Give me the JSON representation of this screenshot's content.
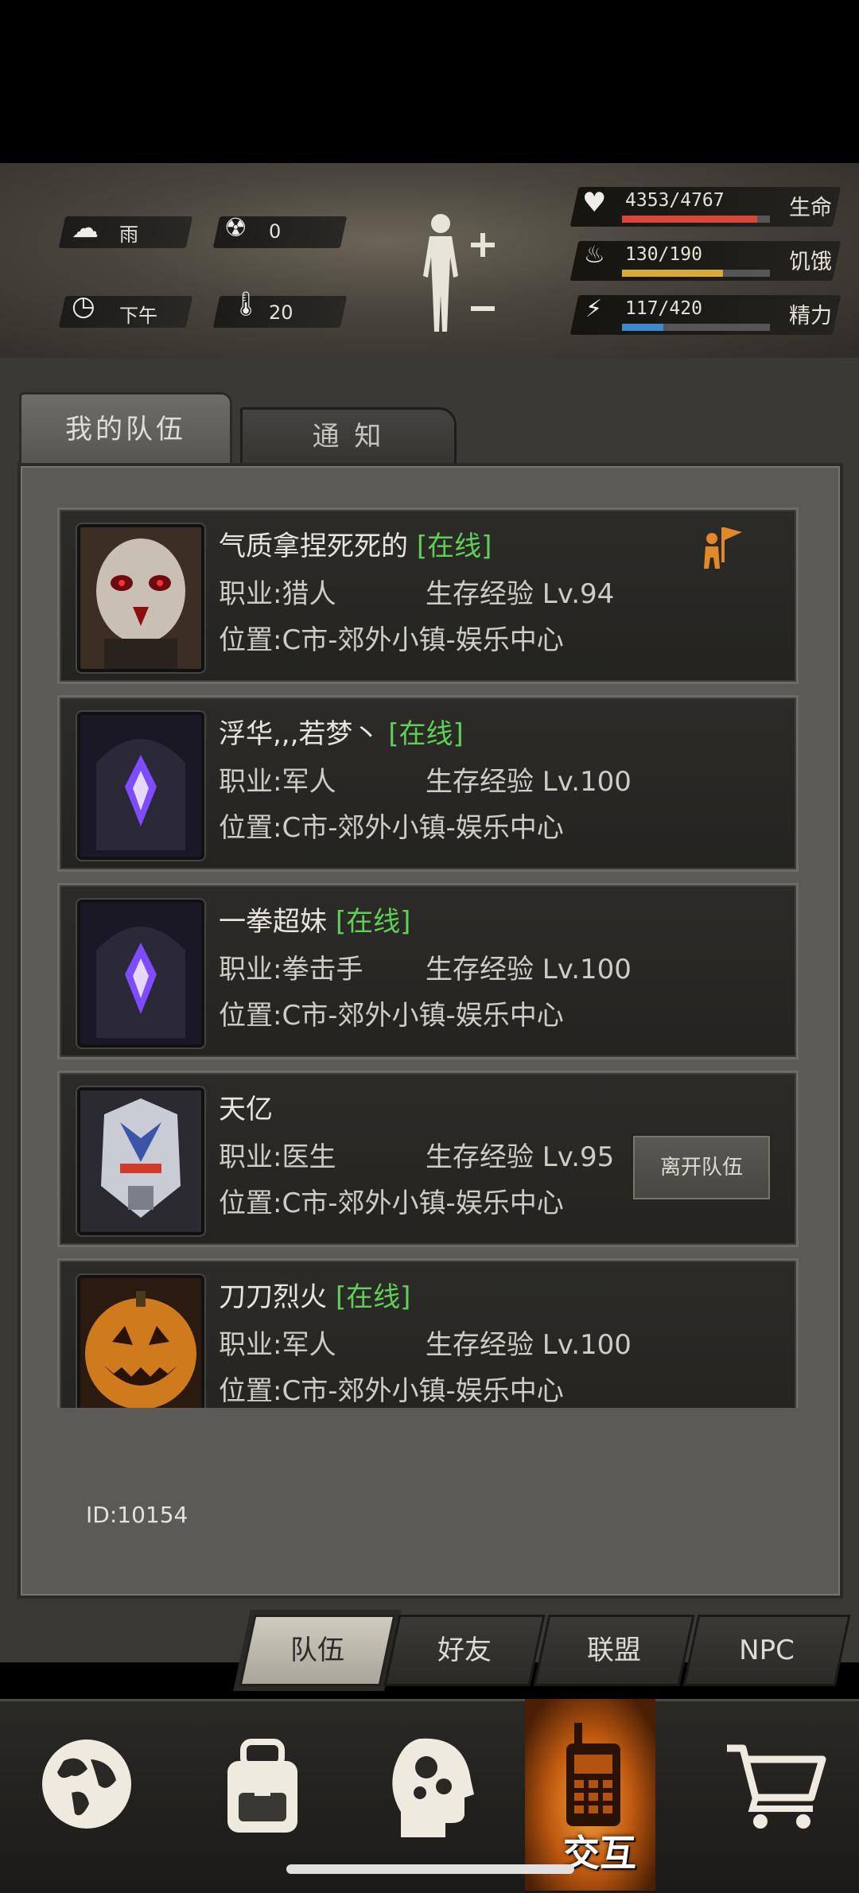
{
  "status": {
    "weather": "雨",
    "radiation": "0",
    "time_of_day": "下午",
    "temperature": "20"
  },
  "vitals": [
    {
      "label": "生命",
      "value": "4353/4767",
      "fraction": 0.913,
      "color": "#d8473a"
    },
    {
      "label": "饥饿",
      "value": "130/190",
      "fraction": 0.684,
      "color": "#d9a93f"
    },
    {
      "label": "精力",
      "value": "117/420",
      "fraction": 0.279,
      "color": "#3f87d1"
    }
  ],
  "tabs": {
    "team": "我的队伍",
    "notice": "通 知"
  },
  "members": [
    {
      "name": "气质拿捏死死的",
      "status": "[在线]",
      "job": "职业:猎人",
      "exp": "生存经验 Lv.94",
      "location": "位置:C市-郊外小镇-娱乐中心"
    },
    {
      "name": "浮华,,,若梦丶",
      "status": "[在线]",
      "job": "职业:军人",
      "exp": "生存经验 Lv.100",
      "location": "位置:C市-郊外小镇-娱乐中心"
    },
    {
      "name": "一拳超妹",
      "status": "[在线]",
      "job": "职业:拳击手",
      "exp": "生存经验 Lv.100",
      "location": "位置:C市-郊外小镇-娱乐中心"
    },
    {
      "name": "天亿",
      "status": "",
      "job": "职业:医生",
      "exp": "生存经验 Lv.95",
      "location": "位置:C市-郊外小镇-娱乐中心",
      "action": "离开队伍"
    },
    {
      "name": "刀刀烈火",
      "status": "[在线]",
      "job": "职业:军人",
      "exp": "生存经验 Lv.100",
      "location": "位置:C市-郊外小镇-娱乐中心"
    }
  ],
  "player_id": "ID:10154",
  "subtabs": [
    "队伍",
    "好友",
    "联盟",
    "NPC"
  ],
  "nav": {
    "active_label": "交互"
  }
}
